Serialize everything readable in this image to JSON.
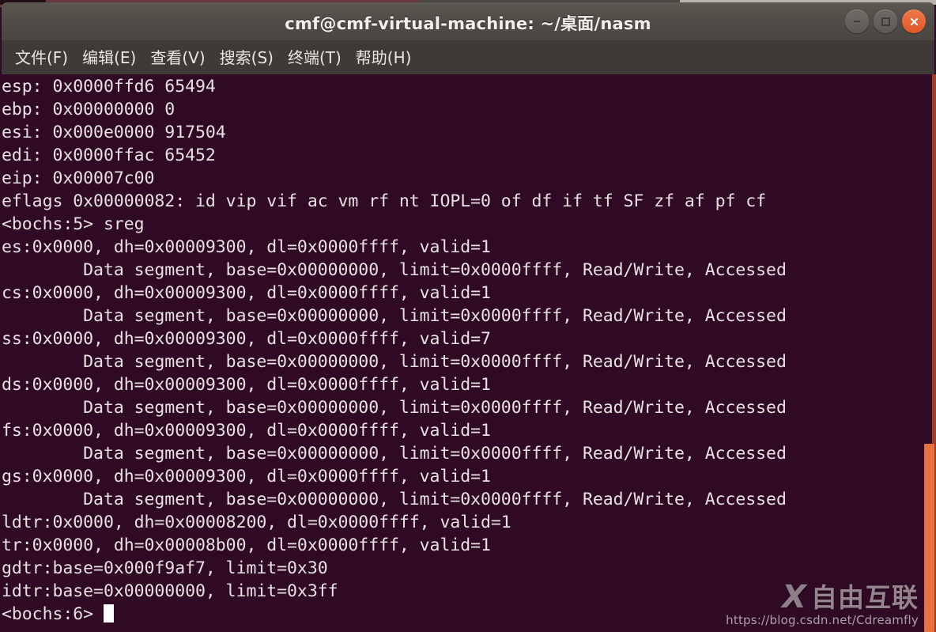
{
  "window": {
    "title": "cmf@cmf-virtual-machine: ~/桌面/nasm",
    "controls": {
      "minimize_label": "minimize",
      "maximize_label": "maximize",
      "close_label": "close"
    }
  },
  "menubar": {
    "items": [
      {
        "label": "文件(F)",
        "name": "menu-file"
      },
      {
        "label": "编辑(E)",
        "name": "menu-edit"
      },
      {
        "label": "查看(V)",
        "name": "menu-view"
      },
      {
        "label": "搜索(S)",
        "name": "menu-search"
      },
      {
        "label": "终端(T)",
        "name": "menu-terminal"
      },
      {
        "label": "帮助(H)",
        "name": "menu-help"
      }
    ]
  },
  "terminal": {
    "background_color": "#300a24",
    "foreground_color": "#e8e1e4",
    "lines": [
      "esp: 0x0000ffd6 65494",
      "ebp: 0x00000000 0",
      "esi: 0x000e0000 917504",
      "edi: 0x0000ffac 65452",
      "eip: 0x00007c00",
      "eflags 0x00000082: id vip vif ac vm rf nt IOPL=0 of df if tf SF zf af pf cf",
      "<bochs:5> sreg",
      "es:0x0000, dh=0x00009300, dl=0x0000ffff, valid=1",
      "        Data segment, base=0x00000000, limit=0x0000ffff, Read/Write, Accessed",
      "cs:0x0000, dh=0x00009300, dl=0x0000ffff, valid=1",
      "        Data segment, base=0x00000000, limit=0x0000ffff, Read/Write, Accessed",
      "ss:0x0000, dh=0x00009300, dl=0x0000ffff, valid=7",
      "        Data segment, base=0x00000000, limit=0x0000ffff, Read/Write, Accessed",
      "ds:0x0000, dh=0x00009300, dl=0x0000ffff, valid=1",
      "        Data segment, base=0x00000000, limit=0x0000ffff, Read/Write, Accessed",
      "fs:0x0000, dh=0x00009300, dl=0x0000ffff, valid=1",
      "        Data segment, base=0x00000000, limit=0x0000ffff, Read/Write, Accessed",
      "gs:0x0000, dh=0x00009300, dl=0x0000ffff, valid=1",
      "        Data segment, base=0x00000000, limit=0x0000ffff, Read/Write, Accessed",
      "ldtr:0x0000, dh=0x00008200, dl=0x0000ffff, valid=1",
      "tr:0x0000, dh=0x00008b00, dl=0x0000ffff, valid=1",
      "gdtr:base=0x000f9af7, limit=0x30",
      "idtr:base=0x00000000, limit=0x3ff"
    ],
    "prompt": "<bochs:6> ",
    "cursor": "block"
  },
  "scrollbar": {
    "thumb_color": "#e8713e",
    "track_color": "#300a24"
  },
  "watermark": {
    "logo_mark": "X",
    "logo_text": "自由互联",
    "url": "https://blog.csdn.net/Cdreamfly"
  }
}
